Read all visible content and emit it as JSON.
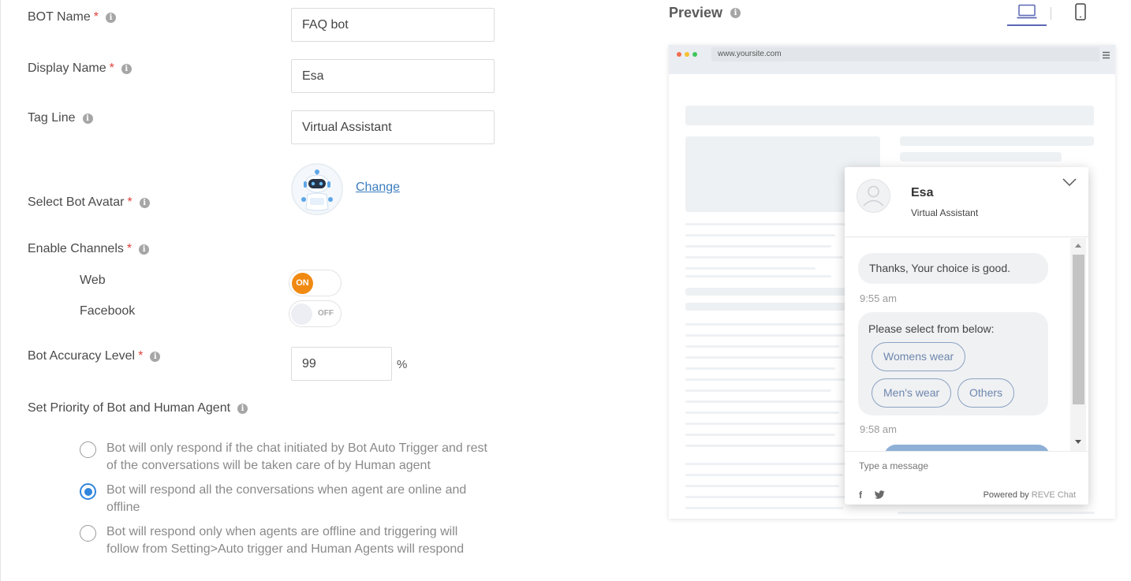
{
  "form": {
    "bot_name": {
      "label": "BOT Name",
      "required": "*",
      "value": "FAQ bot"
    },
    "display_name": {
      "label": "Display Name",
      "required": "*",
      "value": "Esa"
    },
    "tag_line": {
      "label": "Tag Line",
      "value": "Virtual Assistant"
    },
    "avatar": {
      "label": "Select Bot Avatar",
      "required": "*",
      "change_label": "Change"
    },
    "channels": {
      "label": "Enable Channels",
      "required": "*",
      "items": [
        {
          "name": "Web",
          "state": "ON",
          "enabled": true
        },
        {
          "name": "Facebook",
          "state": "OFF",
          "enabled": false
        }
      ]
    },
    "accuracy": {
      "label": "Bot Accuracy Level",
      "required": "*",
      "value": "99",
      "unit": "%"
    },
    "priority": {
      "label": "Set Priority of Bot and Human Agent",
      "options": [
        {
          "text": "Bot will only respond if the chat initiated by Bot Auto Trigger and rest of the conversations will be taken care of by Human agent",
          "checked": false
        },
        {
          "text": "Bot will respond all the conversations when agent are online and offline",
          "checked": true
        },
        {
          "text": "Bot will respond only when agents are offline and triggering will follow from Setting>Auto trigger and Human Agents will respond",
          "checked": false
        }
      ]
    }
  },
  "preview": {
    "title": "Preview",
    "devices": [
      "laptop-icon",
      "mobile-icon"
    ],
    "browser": {
      "url": "www.yoursite.com"
    },
    "widget": {
      "name": "Esa",
      "tagline": "Virtual Assistant",
      "messages": [
        {
          "text": "Thanks, Your choice is good.",
          "time": "9:55 am"
        },
        {
          "text": "Please select from below:",
          "time": "9:58 am",
          "chips": [
            "Womens wear",
            "Men's wear",
            "Others"
          ]
        }
      ],
      "input_placeholder": "Type a message",
      "powered_by": "Powered by",
      "brand": "REVE Chat",
      "social": [
        "f",
        "twitter-icon"
      ]
    }
  },
  "colors": {
    "required": "#e0403a",
    "toggle_on": "#f08a12",
    "radio_checked": "#2f86dc",
    "link": "#3b7dbf",
    "device_active": "#5a67b5",
    "chip_border": "#8aa3c2"
  }
}
